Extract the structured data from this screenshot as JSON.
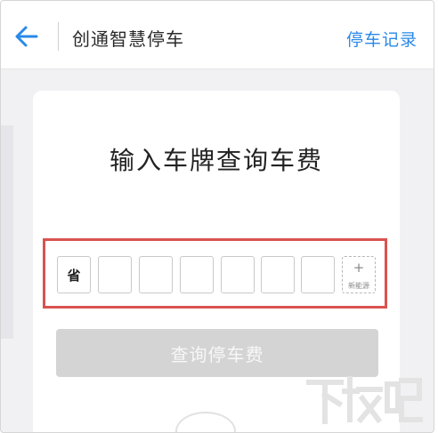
{
  "header": {
    "title": "创通智慧停车",
    "records_link": "停车记录",
    "back_icon": "arrow-left-icon",
    "accent_color": "#2a89e8"
  },
  "card": {
    "title": "输入车牌查询车费",
    "plate": {
      "province_label": "省",
      "character_slots": 6,
      "new_energy_plus": "+",
      "new_energy_label": "新能源"
    },
    "query_button_label": "查询停车费",
    "highlight_color": "#d9534f"
  },
  "watermark": {
    "text": "下载吧"
  }
}
